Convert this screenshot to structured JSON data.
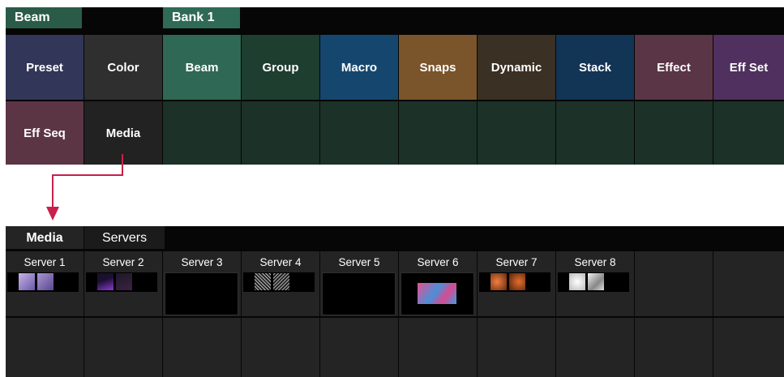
{
  "colors": {
    "panel_bg": "#060606",
    "empty_cell": "#1c3128",
    "arrow": "#c8204a"
  },
  "top_panel": {
    "tabs": [
      {
        "label": "Beam",
        "color": "#2a5a48"
      },
      {
        "label": "Bank 1",
        "color": "#2f6a57"
      }
    ],
    "row1": [
      {
        "label": "Preset",
        "color": "#323658"
      },
      {
        "label": "Color",
        "color": "#2f2f2f"
      },
      {
        "label": "Beam",
        "color": "#2f6855"
      },
      {
        "label": "Group",
        "color": "#1e3e30"
      },
      {
        "label": "Macro",
        "color": "#15476e"
      },
      {
        "label": "Snaps",
        "color": "#7a542a"
      },
      {
        "label": "Dynamic",
        "color": "#3b3024"
      },
      {
        "label": "Stack",
        "color": "#123455"
      },
      {
        "label": "Effect",
        "color": "#5a3545"
      },
      {
        "label": "Eff Set",
        "color": "#4f305f"
      }
    ],
    "row2": [
      {
        "label": "Eff Seq",
        "color": "#5c3545"
      },
      {
        "label": "Media",
        "color": "#222222"
      },
      {
        "label": "",
        "color": "#1c3128"
      },
      {
        "label": "",
        "color": "#1c3128"
      },
      {
        "label": "",
        "color": "#1c3128"
      },
      {
        "label": "",
        "color": "#1c3128"
      },
      {
        "label": "",
        "color": "#1c3128"
      },
      {
        "label": "",
        "color": "#1c3128"
      },
      {
        "label": "",
        "color": "#1c3128"
      },
      {
        "label": "",
        "color": "#1c3128"
      }
    ]
  },
  "bottom_panel": {
    "tabs": [
      {
        "label": "Media",
        "active": true
      },
      {
        "label": "Servers",
        "active": false
      }
    ],
    "servers": [
      {
        "label": "Server 1",
        "preview": "thumbs",
        "thumbs": [
          "#8a78c0",
          "#7b6aa8"
        ]
      },
      {
        "label": "Server 2",
        "preview": "thumbs",
        "thumbs": [
          "#5a2a90",
          "#2a1a30"
        ]
      },
      {
        "label": "Server 3",
        "preview": "empty"
      },
      {
        "label": "Server 4",
        "preview": "thumbs",
        "thumbs": [
          "#7a7a7a",
          "#5a5a5a"
        ]
      },
      {
        "label": "Server 5",
        "preview": "empty"
      },
      {
        "label": "Server 6",
        "preview": "image",
        "image_color": "#d04a80"
      },
      {
        "label": "Server 7",
        "preview": "thumbs",
        "thumbs": [
          "#c05a2a",
          "#a04820"
        ]
      },
      {
        "label": "Server 8",
        "preview": "thumbs",
        "thumbs": [
          "#e8e8e8",
          "#bfbfbf"
        ]
      },
      {
        "label": "",
        "preview": "none"
      },
      {
        "label": "",
        "preview": "none"
      }
    ]
  }
}
